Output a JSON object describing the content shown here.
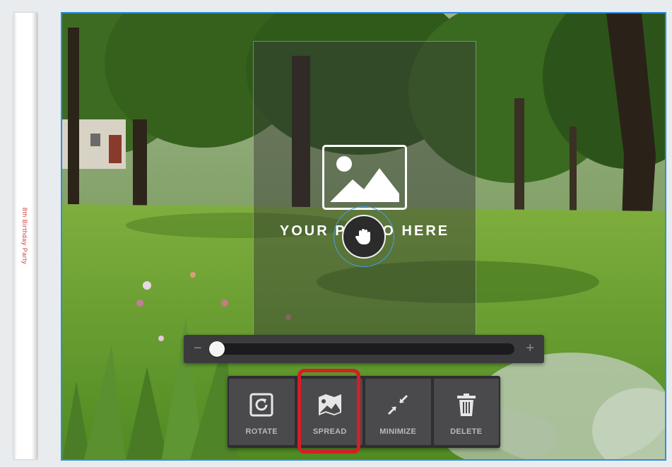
{
  "spine": {
    "text": "8th Birthday Party"
  },
  "placeholder": {
    "text": "YOUR PHOTO HERE",
    "icon": "image-icon"
  },
  "drag_handle": {
    "icon": "hand-grab-icon"
  },
  "zoom": {
    "minus_label": "−",
    "plus_label": "+",
    "level": 0.0
  },
  "toolbar": {
    "items": [
      {
        "label": "ROTATE",
        "icon": "rotate-icon"
      },
      {
        "label": "SPREAD",
        "icon": "spread-map-icon"
      },
      {
        "label": "MINIMIZE",
        "icon": "minimize-arrows-icon"
      },
      {
        "label": "DELETE",
        "icon": "trash-icon"
      }
    ]
  },
  "colors": {
    "selection_border": "#2f8ee0",
    "highlight": "#d51e27",
    "spine_text": "#d23b3b",
    "toolbar_bg": "#2e2e31"
  }
}
